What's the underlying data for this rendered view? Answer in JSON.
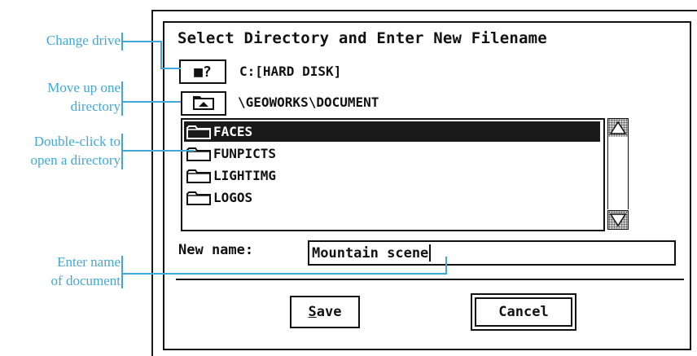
{
  "annotations": {
    "change_drive": "Change drive",
    "move_up_line1": "Move up one",
    "move_up_line2": "directory",
    "double_click_line1": "Double-click to",
    "double_click_line2": "open a directory",
    "enter_name_line1": "Enter name",
    "enter_name_line2": "of document"
  },
  "dialog": {
    "title": "Select Directory and Enter New Filename",
    "drive_button_glyph": "■?",
    "drive_label": "C:[HARD DISK]",
    "up_button_icon": "folder-up-icon",
    "current_directory": "\\GEOWORKS\\DOCUMENT",
    "items": [
      {
        "label": "FACES",
        "icon": "folder-icon",
        "selected": true
      },
      {
        "label": "FUNPICTS",
        "icon": "folder-icon",
        "selected": false
      },
      {
        "label": "LIGHTIMG",
        "icon": "folder-icon",
        "selected": false
      },
      {
        "label": "LOGOS",
        "icon": "folder-icon",
        "selected": false
      }
    ],
    "scrollbar": {
      "up_icon": "scroll-up-arrow-icon",
      "down_icon": "scroll-down-arrow-icon"
    },
    "new_name_label": "New name:",
    "new_name_value": "Mountain scene",
    "save_hotkey": "S",
    "save_rest": "ave",
    "cancel_label": "Cancel"
  },
  "colors": {
    "annotation": "#3fa8d8",
    "selection": "#1a1a1a"
  }
}
